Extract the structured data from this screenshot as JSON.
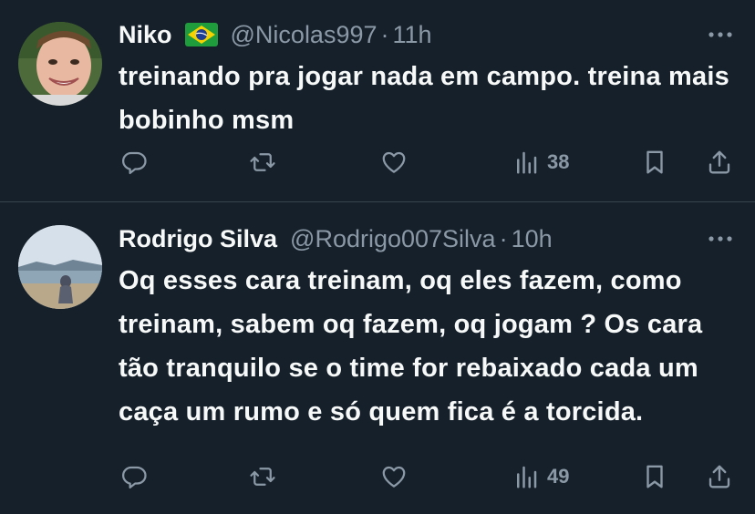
{
  "tweets": [
    {
      "name": "Niko",
      "handle": "@Nicolas997",
      "dot": "·",
      "time": "11h",
      "text": "treinando pra jogar nada em campo. treina mais bobinho msm",
      "views": "38",
      "has_flag": true
    },
    {
      "name": "Rodrigo Silva",
      "handle": "@Rodrigo007Silva",
      "dot": "·",
      "time": "10h",
      "text": "Oq esses cara treinam, oq eles fazem, como treinam, sabem oq fazem, oq jogam ? Os cara tão tranquilo se o time for rebaixado cada um caça um rumo e só quem fica é a torcida.",
      "views": "49",
      "has_flag": false
    }
  ],
  "colors": {
    "background": "#15202b",
    "text": "#f7f9f9",
    "muted": "#8b98a5",
    "divider": "#38444d"
  },
  "icons": [
    "reply-icon",
    "retweet-icon",
    "like-icon",
    "views-icon",
    "bookmark-icon",
    "share-icon",
    "more-icon",
    "brazil-flag"
  ]
}
